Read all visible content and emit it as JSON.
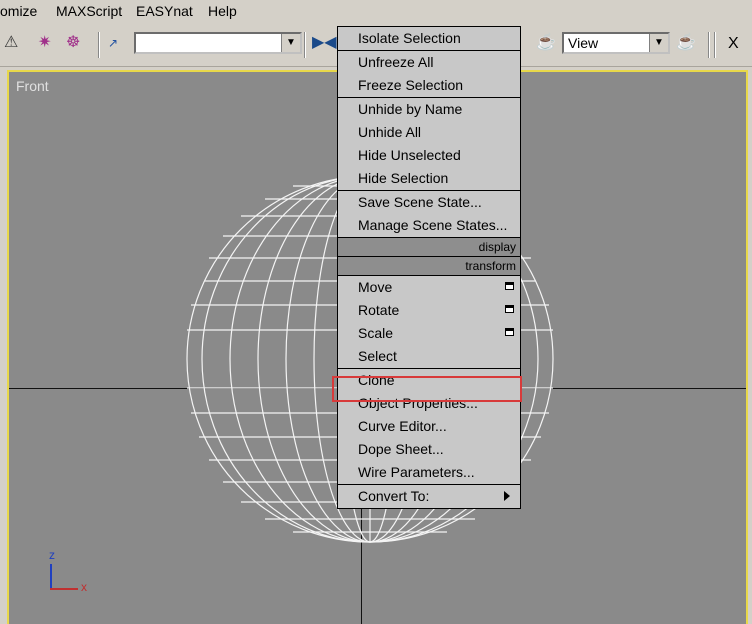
{
  "menubar": {
    "items": [
      "omize",
      "MAXScript",
      "EASYnat",
      "Help"
    ]
  },
  "toolbar": {
    "selection_set_value": "",
    "view_combo_value": "View",
    "close_label": "X"
  },
  "viewport": {
    "label": "Front",
    "gizmo": {
      "z": "z",
      "x": "x"
    }
  },
  "context_menu": {
    "display_group": [
      "Isolate Selection",
      "Unfreeze All",
      "Freeze Selection",
      "Unhide by Name",
      "Unhide All",
      "Hide Unselected",
      "Hide Selection",
      "Save Scene State...",
      "Manage Scene States..."
    ],
    "display_header": "display",
    "transform_header": "transform",
    "transform_group": [
      "Move",
      "Rotate",
      "Scale",
      "Select",
      "Clone",
      "Object Properties...",
      "Curve Editor...",
      "Dope Sheet...",
      "Wire Parameters...",
      "Convert To:"
    ],
    "highlighted_item": "Object Properties..."
  },
  "colors": {
    "viewport_bg": "#8a8a8a",
    "viewport_border": "#e8d84a",
    "highlight_border": "#d83a3a",
    "menu_bg": "#c8c8c8",
    "header_bg": "#8e8e8e"
  }
}
